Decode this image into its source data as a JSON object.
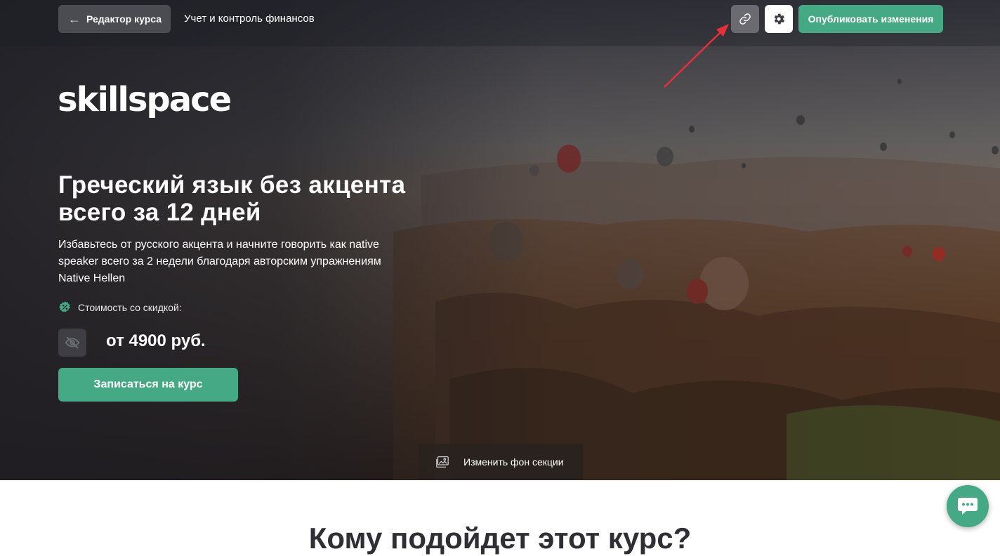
{
  "topbar": {
    "back_label": "Редактор курса",
    "course_name": "Учет и контроль финансов",
    "link_icon": "link-icon",
    "settings_icon": "gear-icon",
    "publish_label": "Опубликовать изменения"
  },
  "hero": {
    "logo_text": "skillspace",
    "headline": "Греческий язык без акцента всего за 12 дней",
    "subtitle": "Избавьтесь от русского акцента и начните говорить как native speaker всего за 2 недели благодаря авторским упражнениям Native Hellen",
    "discount_label": "Стоимость со скидкой:",
    "price": "от 4900 руб.",
    "enroll_label": "Записаться на курс",
    "change_bg_label": "Изменить фон секции"
  },
  "next_section": {
    "title": "Кому подойдет этот курс?"
  },
  "colors": {
    "accent": "#45a985",
    "topbar_button": "#4b4b52",
    "annotation_arrow": "#e5303a"
  }
}
